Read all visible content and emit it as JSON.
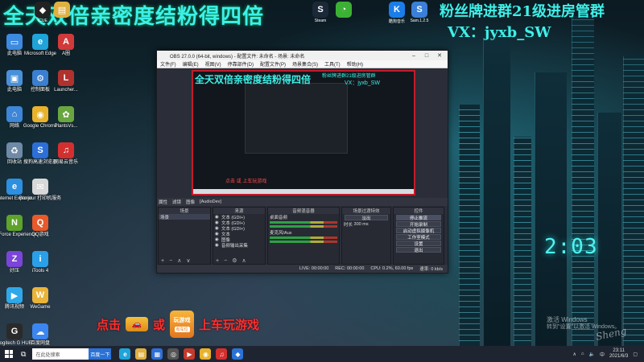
{
  "banner": {
    "left": "全天双倍亲密度结粉得四倍",
    "right_line1": "粉丝牌进群21级进房管群",
    "right_line2": "VX：jyxb_SW"
  },
  "desktop_icons": [
    {
      "label": "此电脑",
      "icon": "computer-icon",
      "glyph": "▭",
      "color": "#3c8be0"
    },
    {
      "label": "Microsoft Edge",
      "icon": "edge-icon",
      "glyph": "e",
      "color": "#1fa3d9"
    },
    {
      "label": "A圈",
      "icon": "app-a-icon",
      "glyph": "A",
      "color": "#d03a3a"
    },
    {
      "label": "此电脑",
      "icon": "pc-icon",
      "glyph": "▣",
      "color": "#4a90d9"
    },
    {
      "label": "控制面板",
      "icon": "control-panel-icon",
      "glyph": "⚙",
      "color": "#3b7fd0"
    },
    {
      "label": "Launcher...",
      "icon": "launcher-icon",
      "glyph": "L",
      "color": "#b0322e"
    },
    {
      "label": "网络",
      "icon": "network-icon",
      "glyph": "⌂",
      "color": "#3d86d8"
    },
    {
      "label": "Google Chrome",
      "icon": "chrome-icon",
      "glyph": "◉",
      "color": "#e7b32c"
    },
    {
      "label": "PlantsVs...",
      "icon": "plants-icon",
      "glyph": "✿",
      "color": "#6aa640"
    },
    {
      "label": "回收站",
      "icon": "recycle-bin-icon",
      "glyph": "♻",
      "color": "#6f8aa6"
    },
    {
      "label": "搜狗高速浏览器",
      "icon": "sogou-browser-icon",
      "glyph": "S",
      "color": "#2c6fd8"
    },
    {
      "label": "网易云音乐",
      "icon": "netease-music-icon",
      "glyph": "♫",
      "color": "#d42f2f"
    },
    {
      "label": "Internet Explorer",
      "icon": "ie-icon",
      "glyph": "e",
      "color": "#2d8fe0"
    },
    {
      "label": "Bonjour 打印机服务",
      "icon": "bonjour-icon",
      "glyph": "✉",
      "color": "#d8d8d8"
    },
    {
      "label": "",
      "icon": "",
      "glyph": "",
      "color": ""
    },
    {
      "label": "GeForce Experience",
      "icon": "geforce-icon",
      "glyph": "N",
      "color": "#5ea32a"
    },
    {
      "label": "QQ游戏",
      "icon": "qq-game-icon",
      "glyph": "Q",
      "color": "#e85a2a"
    },
    {
      "label": "",
      "icon": "",
      "glyph": "",
      "color": ""
    },
    {
      "label": "好压",
      "icon": "haozip-icon",
      "glyph": "Z",
      "color": "#7b45d9"
    },
    {
      "label": "iTools 4",
      "icon": "itools-icon",
      "glyph": "i",
      "color": "#2aa0e8"
    },
    {
      "label": "",
      "icon": "",
      "glyph": "",
      "color": ""
    },
    {
      "label": "腾讯视频",
      "icon": "tencent-video-icon",
      "glyph": "▶",
      "color": "#2fa8ea"
    },
    {
      "label": "WeGame",
      "icon": "wegame-icon",
      "glyph": "W",
      "color": "#e9b43a"
    },
    {
      "label": "",
      "icon": "",
      "glyph": "",
      "color": ""
    },
    {
      "label": "Logitech G HUB",
      "icon": "logitech-icon",
      "glyph": "G",
      "color": "#2a2a2a"
    },
    {
      "label": "百度网盘",
      "icon": "baidu-netdisk-icon",
      "glyph": "☁",
      "color": "#3b86f0"
    }
  ],
  "top_apps": [
    {
      "label": "iCUE",
      "icon": "icue-icon",
      "glyph": "◆",
      "color": "#222"
    },
    {
      "label": "",
      "icon": "folder-icon",
      "glyph": "▤",
      "color": "#e0b040"
    },
    {
      "label": "Steam",
      "icon": "steam-icon",
      "glyph": "S",
      "color": "#1b2838"
    },
    {
      "label": "",
      "icon": "wechat-icon",
      "glyph": "◔",
      "color": "#3cb034"
    },
    {
      "label": "酷狗音乐",
      "icon": "kugou-icon",
      "glyph": "K",
      "color": "#1a7de8"
    },
    {
      "label": "Sam.1.2.5",
      "icon": "sam-icon",
      "glyph": "S",
      "color": "#3a7fd8"
    }
  ],
  "obs": {
    "title": "OBS 27.0.0 (64-bit, windows) - 配置文件: 未命名 - 场景: 未命名",
    "menu": [
      "文件(F)",
      "编辑(E)",
      "视图(V)",
      "停靠部件(D)",
      "配置文件(P)",
      "场景集合(S)",
      "工具(T)",
      "帮助(H)"
    ],
    "preview_text1": "全天双倍亲密度结粉得四倍",
    "preview_text2": "粉丝牌进群21级进房管群",
    "preview_text3": "VX：jyxb_SW",
    "preview_bottom": "点击 或 上车玩游戏",
    "toolbar": [
      "属性",
      "滤镜",
      "图像",
      "[AudioDev]"
    ],
    "docks": {
      "scenes_title": "场景",
      "scenes": [
        "场景"
      ],
      "sources_title": "来源",
      "sources": [
        "文本 (GDI+)",
        "文本 (GDI+)",
        "文本 (GDI+)",
        "文本",
        "图像",
        "音频输出采集"
      ],
      "mixer_title": "音频混音器",
      "mixer": [
        "桌面音频",
        "麦克风/Aux"
      ],
      "transitions_title": "场景过渡特效",
      "transition_type": "淡出",
      "duration_label": "时长",
      "duration_value": "300 ms",
      "controls_title": "控件",
      "controls": [
        "停止推流",
        "开始录制",
        "启动虚拟摄像机",
        "工作室模式",
        "设置",
        "退出"
      ]
    },
    "status": [
      "LIVE: 00:00:00",
      "REC: 00:00:00",
      "CPU: 0.2%, 60.00 fps",
      "速率: 0 kb/s"
    ]
  },
  "ad": {
    "click": "点击",
    "or": "或",
    "play": "上车玩游戏",
    "game_name": "玩游戏",
    "game_tag": "有车位"
  },
  "watermark": {
    "line1": "激活 Windows",
    "line2": "转到\"设置\"以激活 Windows。",
    "signature": "Sheng"
  },
  "taskbar": {
    "search_placeholder": "在此处搜索",
    "search_button": "百度一下",
    "time": "23:11",
    "date": "2021/6/3"
  }
}
